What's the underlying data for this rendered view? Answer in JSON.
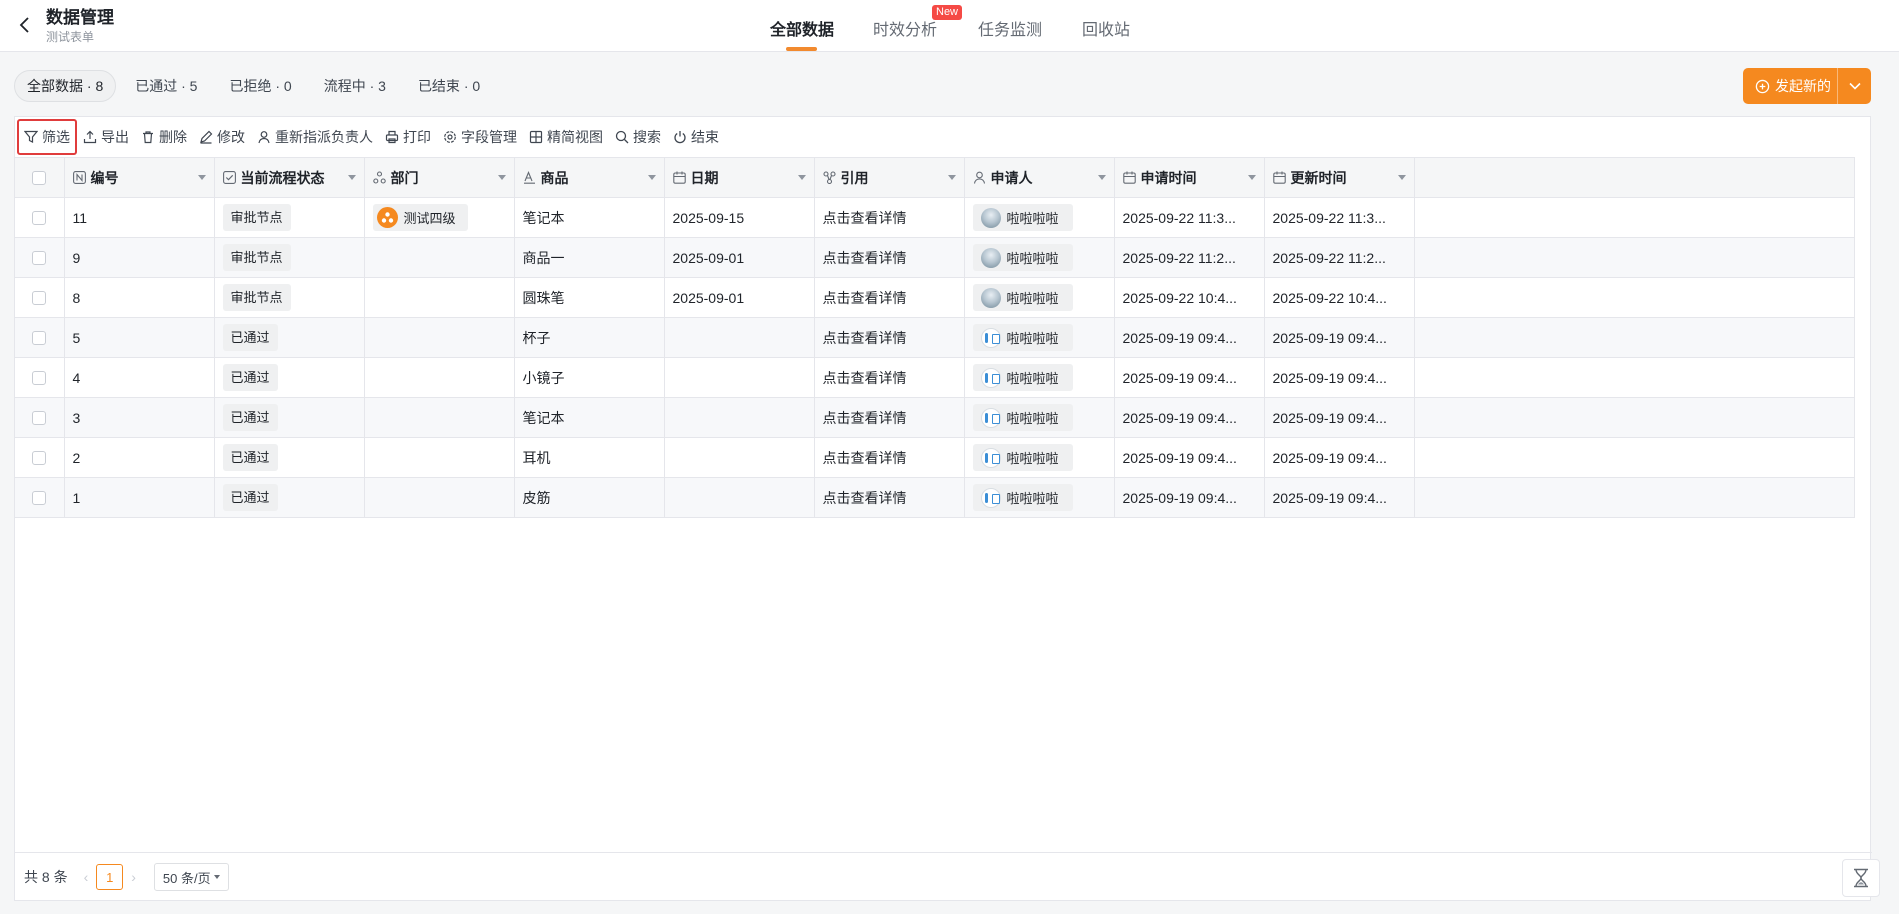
{
  "header": {
    "title": "数据管理",
    "subtitle": "测试表单",
    "tabs": [
      {
        "label": "全部数据",
        "active": true
      },
      {
        "label": "时效分析",
        "badge": "New"
      },
      {
        "label": "任务监测"
      },
      {
        "label": "回收站"
      }
    ]
  },
  "filters": [
    {
      "label": "全部数据 · 8",
      "active": true
    },
    {
      "label": "已通过 · 5"
    },
    {
      "label": "已拒绝 · 0"
    },
    {
      "label": "流程中 · 3"
    },
    {
      "label": "已结束 · 0"
    }
  ],
  "new_button": {
    "label": "发起新的"
  },
  "toolbar": {
    "filter": "筛选",
    "export": "导出",
    "delete": "删除",
    "edit": "修改",
    "reassign": "重新指派负责人",
    "print": "打印",
    "fields": "字段管理",
    "compact": "精简视图",
    "search": "搜索",
    "end": "结束"
  },
  "table": {
    "columns": [
      "编号",
      "当前流程状态",
      "部门",
      "商品",
      "日期",
      "引用",
      "申请人",
      "申请时间",
      "更新时间"
    ],
    "rows": [
      {
        "id": "11",
        "status": "审批节点",
        "dept": "测试四级",
        "product": "笔记本",
        "date": "2025-09-15",
        "ref": "点击查看详情",
        "applicant": "啦啦啦啦",
        "apply_time": "2025-09-22 11:3...",
        "update_time": "2025-09-22 11:3..."
      },
      {
        "id": "9",
        "status": "审批节点",
        "dept": "",
        "product": "商品一",
        "date": "2025-09-01",
        "ref": "点击查看详情",
        "applicant": "啦啦啦啦",
        "apply_time": "2025-09-22 11:2...",
        "update_time": "2025-09-22 11:2..."
      },
      {
        "id": "8",
        "status": "审批节点",
        "dept": "",
        "product": "圆珠笔",
        "date": "2025-09-01",
        "ref": "点击查看详情",
        "applicant": "啦啦啦啦",
        "apply_time": "2025-09-22 10:4...",
        "update_time": "2025-09-22 10:4..."
      },
      {
        "id": "5",
        "status": "已通过",
        "dept": "",
        "product": "杯子",
        "date": "",
        "ref": "点击查看详情",
        "applicant": "啦啦啦啦",
        "apply_time": "2025-09-19 09:4...",
        "update_time": "2025-09-19 09:4..."
      },
      {
        "id": "4",
        "status": "已通过",
        "dept": "",
        "product": "小镜子",
        "date": "",
        "ref": "点击查看详情",
        "applicant": "啦啦啦啦",
        "apply_time": "2025-09-19 09:4...",
        "update_time": "2025-09-19 09:4..."
      },
      {
        "id": "3",
        "status": "已通过",
        "dept": "",
        "product": "笔记本",
        "date": "",
        "ref": "点击查看详情",
        "applicant": "啦啦啦啦",
        "apply_time": "2025-09-19 09:4...",
        "update_time": "2025-09-19 09:4..."
      },
      {
        "id": "2",
        "status": "已通过",
        "dept": "",
        "product": "耳机",
        "date": "",
        "ref": "点击查看详情",
        "applicant": "啦啦啦啦",
        "apply_time": "2025-09-19 09:4...",
        "update_time": "2025-09-19 09:4..."
      },
      {
        "id": "1",
        "status": "已通过",
        "dept": "",
        "product": "皮筋",
        "date": "",
        "ref": "点击查看详情",
        "applicant": "啦啦啦啦",
        "apply_time": "2025-09-19 09:4...",
        "update_time": "2025-09-19 09:4..."
      }
    ]
  },
  "pagination": {
    "total": "共 8 条",
    "current": "1",
    "page_size": "50 条/页"
  },
  "colors": {
    "accent": "#f5891f",
    "highlight_border": "#e03c3c",
    "badge": "#f54a45"
  }
}
